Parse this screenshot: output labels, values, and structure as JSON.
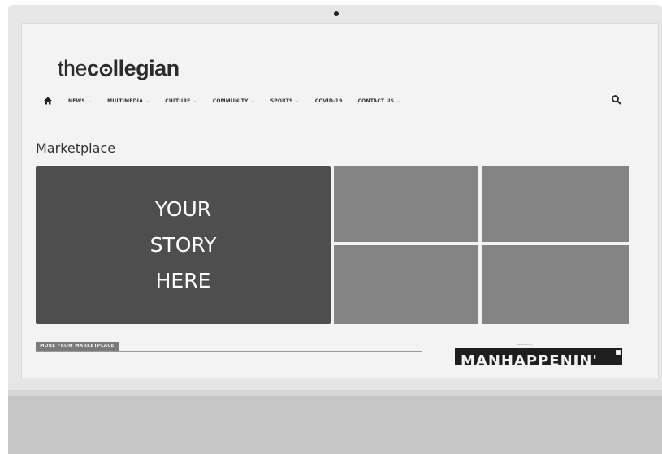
{
  "site": {
    "logo_light": "the",
    "logo_bold_1": "c",
    "logo_bold_2": "llegian",
    "logo_tagline": "................."
  },
  "nav": {
    "items": [
      {
        "label": "NEWS",
        "chevron": "⌄"
      },
      {
        "label": "MULTIMEDIA",
        "chevron": "⌄"
      },
      {
        "label": "CULTURE",
        "chevron": "⌄"
      },
      {
        "label": "COMMUNITY",
        "chevron": "⌄"
      },
      {
        "label": "SPORTS",
        "chevron": "⌄"
      },
      {
        "label": "COVID-19",
        "chevron": ""
      },
      {
        "label": "CONTACT US",
        "chevron": "⌄"
      }
    ],
    "home_icon": "home-icon",
    "search_icon": "search-icon"
  },
  "section": {
    "title": "Marketplace",
    "hero_line_1": "YOUR",
    "hero_line_2": "STORY",
    "hero_line_3": "HERE",
    "more_label": "MORE FROM MARKETPLACE"
  },
  "ad": {
    "label": "advertisement",
    "banner_text": "MANHAPPENIN'"
  },
  "colors": {
    "hero_bg": "#4e4e4e",
    "tile_bg": "#848484",
    "screen_bg": "#f3f3f3"
  }
}
